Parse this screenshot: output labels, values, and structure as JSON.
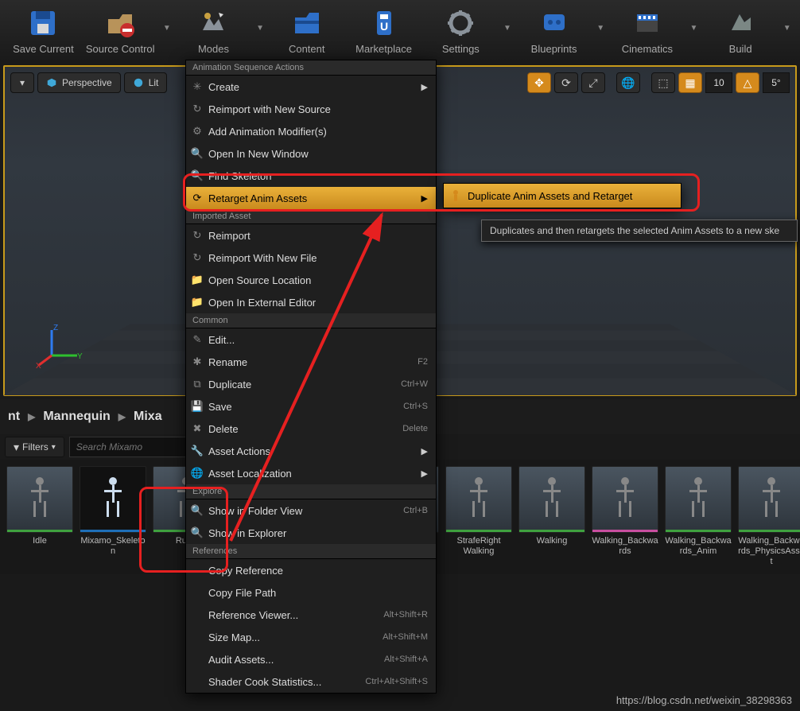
{
  "toolbar": [
    {
      "label": "Save Current",
      "caret": false
    },
    {
      "label": "Source Control",
      "caret": true
    },
    {
      "label": "Modes",
      "caret": true
    },
    {
      "label": "Content",
      "caret": false
    },
    {
      "label": "Marketplace",
      "caret": false
    },
    {
      "label": "Settings",
      "caret": true
    },
    {
      "label": "Blueprints",
      "caret": true
    },
    {
      "label": "Cinematics",
      "caret": true
    },
    {
      "label": "Build",
      "caret": true
    }
  ],
  "viewport": {
    "perspective": "Perspective",
    "lit": "Lit",
    "grid_snap": "10",
    "angle_snap": "5°"
  },
  "breadcrumb": [
    "nt",
    "Mannequin",
    "Mixa"
  ],
  "filter": {
    "label": "Filters",
    "search_placeholder": "Search Mixamo"
  },
  "assets": [
    {
      "label": "Idle",
      "stripe": "green"
    },
    {
      "label": "Mixamo_Skeleton",
      "stripe": "blue",
      "skeleton": true
    },
    {
      "label": "Runn",
      "stripe": "green"
    },
    {
      "label": "",
      "stripe": ""
    },
    {
      "label": "",
      "stripe": ""
    },
    {
      "label": "",
      "stripe": ""
    },
    {
      "label": "StrafeRight Walking",
      "stripe": "green"
    },
    {
      "label": "Walking",
      "stripe": "green"
    },
    {
      "label": "Walking_Backwards",
      "stripe": "pink"
    },
    {
      "label": "Walking_Backwards_Anim",
      "stripe": "green"
    },
    {
      "label": "Walking_Backwards_PhysicsAsset",
      "stripe": "green"
    }
  ],
  "menu": {
    "sections": [
      {
        "header": "Animation Sequence Actions",
        "items": [
          {
            "label": "Create",
            "arrow": true,
            "icon": "✳"
          },
          {
            "label": "Reimport with New Source",
            "icon": "↻"
          },
          {
            "label": "Add Animation Modifier(s)",
            "icon": "⚙"
          },
          {
            "label": "Open In New Window",
            "icon": "🔍"
          },
          {
            "label": "Find Skeleton",
            "icon": "🔍"
          },
          {
            "label": "Retarget Anim Assets",
            "arrow": true,
            "hi": true,
            "icon": "⟳"
          }
        ]
      },
      {
        "header": "Imported Asset",
        "items": [
          {
            "label": "Reimport",
            "icon": "↻"
          },
          {
            "label": "Reimport With New File",
            "icon": "↻"
          },
          {
            "label": "Open Source Location",
            "icon": "📁"
          },
          {
            "label": "Open In External Editor",
            "icon": "📁"
          }
        ]
      },
      {
        "header": "Common",
        "items": [
          {
            "label": "Edit...",
            "icon": "✎"
          },
          {
            "label": "Rename",
            "shortcut": "F2",
            "icon": "✱"
          },
          {
            "label": "Duplicate",
            "shortcut": "Ctrl+W",
            "icon": "⧉"
          },
          {
            "label": "Save",
            "shortcut": "Ctrl+S",
            "icon": "💾"
          },
          {
            "label": "Delete",
            "shortcut": "Delete",
            "icon": "✖"
          },
          {
            "label": "Asset Actions",
            "arrow": true,
            "icon": "🔧"
          },
          {
            "label": "Asset Localization",
            "arrow": true,
            "icon": "🌐"
          }
        ]
      },
      {
        "header": "Explore",
        "items": [
          {
            "label": "Show in Folder View",
            "shortcut": "Ctrl+B",
            "icon": "🔍"
          },
          {
            "label": "Show in Explorer",
            "icon": "🔍"
          }
        ]
      },
      {
        "header": "References",
        "items": [
          {
            "label": "Copy Reference"
          },
          {
            "label": "Copy File Path"
          },
          {
            "label": "Reference Viewer...",
            "shortcut": "Alt+Shift+R"
          },
          {
            "label": "Size Map...",
            "shortcut": "Alt+Shift+M"
          },
          {
            "label": "Audit Assets...",
            "shortcut": "Alt+Shift+A"
          },
          {
            "label": "Shader Cook Statistics...",
            "shortcut": "Ctrl+Alt+Shift+S"
          }
        ]
      }
    ]
  },
  "submenu": {
    "label": "Duplicate Anim Assets and Retarget"
  },
  "tooltip": "Duplicates and then retargets the selected Anim Assets to a new ske",
  "watermark": "https://blog.csdn.net/weixin_38298363"
}
